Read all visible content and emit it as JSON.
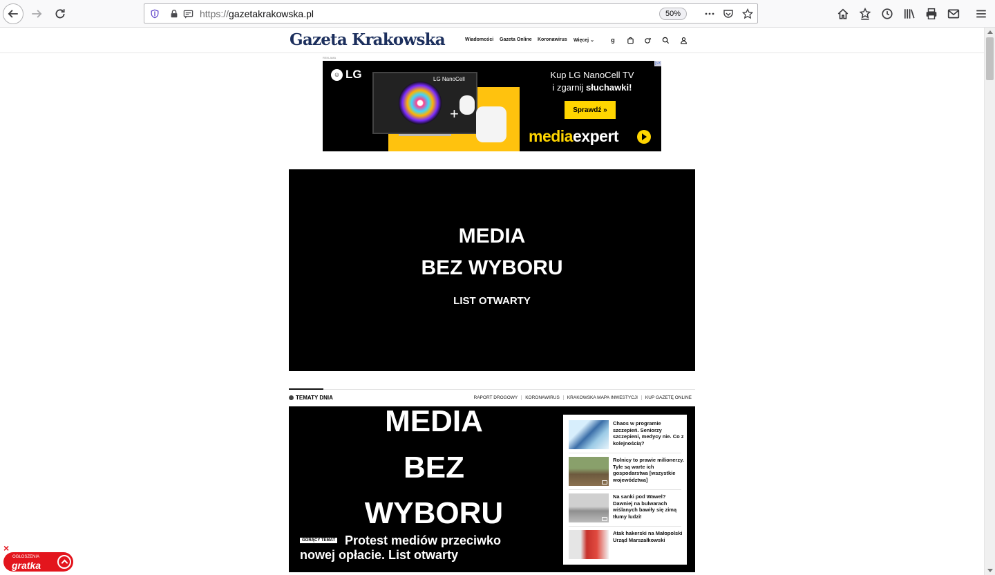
{
  "browser": {
    "url_prefix": "https://",
    "url_domain": "gazetakrakowska.pl",
    "zoom": "50%"
  },
  "site": {
    "logo": "Gazeta Krakowska",
    "nav": [
      "Wiadomości",
      "Gazeta Online",
      "Koronawirus",
      "Więcej"
    ],
    "nav_g": "g"
  },
  "ad": {
    "label": "REKLAMA",
    "brand_logo": "LG",
    "tv_label": "LG NanoCell",
    "line1": "Kup LG NanoCell TV",
    "line2_prefix": "i zgarnij ",
    "line2_bold": "słuchawki!",
    "cta": "Sprawdź »",
    "store_yellow": "media",
    "store_white": "expert",
    "close": "▷×"
  },
  "video": {
    "line1": "MEDIA",
    "line2": "BEZ WYBORU",
    "line3": "LIST OTWARTY"
  },
  "topics": {
    "title": "TEMATY DNIA",
    "links": [
      "RAPORT DROGOWY",
      "KORONAWIRUS",
      "KRAKOWSKA MAPA INWESTYCJI",
      "KUP GAZETĘ ONLINE"
    ]
  },
  "hero": {
    "word1": "MEDIA",
    "word2": "BEZ",
    "word3": "WYBORU",
    "badge": "GORĄCY TEMAT",
    "title": "Protest mediów przeciwko nowej opłacie. List otwarty"
  },
  "side_items": [
    {
      "title": "Chaos w programie szczepień. Seniorzy szczepieni, medycy nie. Co z kolejnością?"
    },
    {
      "title": "Rolnicy to prawie milionerzy. Tyle są warte ich gospodarstwa [wszystkie województwa]"
    },
    {
      "title": "Na sanki pod Wawel? Dawniej na bulwarach wiślanych bawiły się zimą tłumy ludzi!"
    },
    {
      "title": "Atak hakerski na Małopolski Urząd Marszałkowski"
    }
  ],
  "gratka": {
    "close": "×",
    "subtitle": "OGŁOSZENIA",
    "name": "gratka"
  }
}
